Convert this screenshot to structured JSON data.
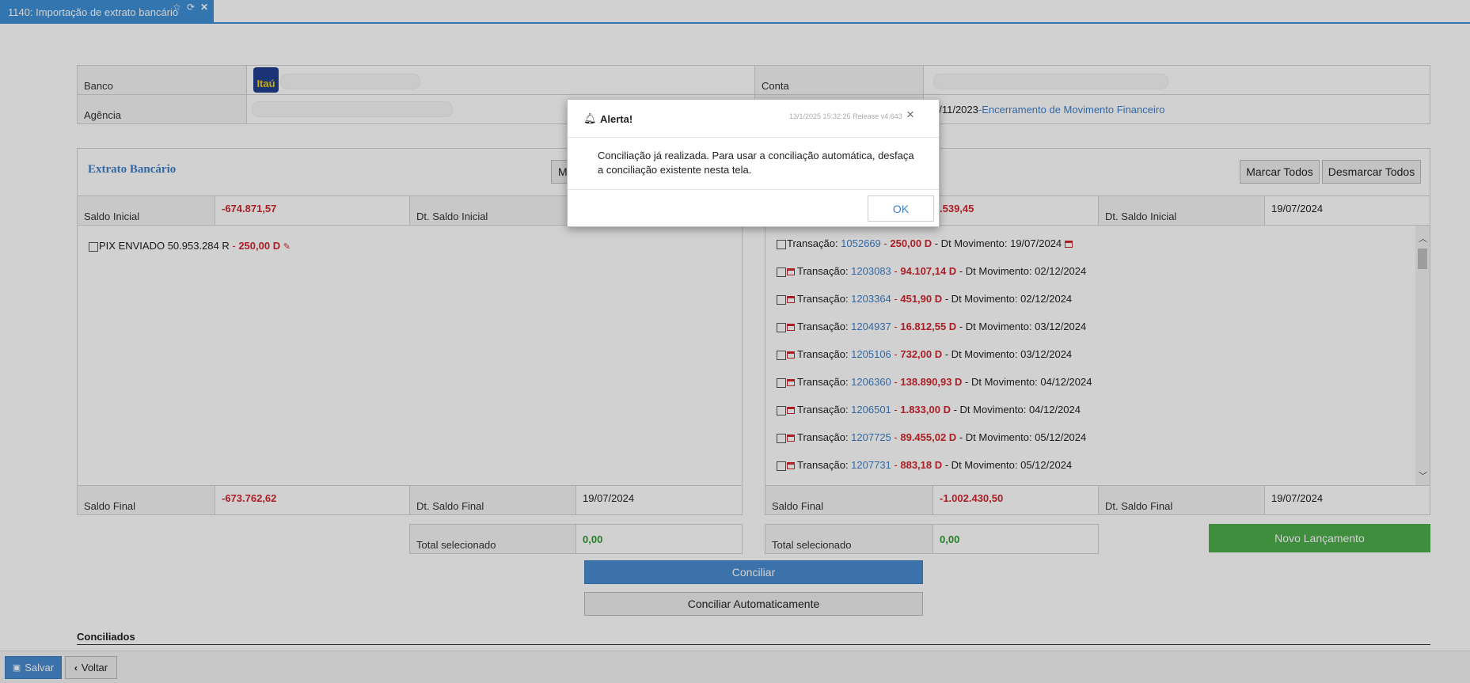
{
  "tab": {
    "title": "1140: Importação de extrato bancário"
  },
  "header": {
    "banco_label": "Banco",
    "bank_logo_text": "Itaú",
    "agencia_label": "Agência",
    "conta_label": "Conta",
    "movimento_date": "0/11/2023",
    "movimento_sep": " - ",
    "movimento_link": "Encerramento de Movimento Financeiro"
  },
  "left_panel": {
    "title": "Extrato Bancário",
    "partial_button": "M",
    "saldo_inicial_label": "Saldo Inicial",
    "saldo_inicial_value": "-674.871,57",
    "dt_saldo_inicial_label": "Dt. Saldo Inicial",
    "entries": [
      {
        "desc": "PIX ENVIADO 50.953.284 R",
        "sep": " - ",
        "value": "250,00 D"
      }
    ],
    "saldo_final_label": "Saldo Final",
    "saldo_final_value": "-673.762,62",
    "dt_saldo_final_label": "Dt. Saldo Final",
    "dt_saldo_final_value": "19/07/2024",
    "total_label": "Total selecionado",
    "total_value": "0,00"
  },
  "right_panel": {
    "marcar_todos": "Marcar Todos",
    "desmarcar_todos": "Desmarcar Todos",
    "saldo_inicial_value_partial": ".539,45",
    "dt_saldo_inicial_label": "Dt. Saldo Inicial",
    "dt_saldo_inicial_value": "19/07/2024",
    "tx_label": "Transação: ",
    "dt_label": " - Dt Movimento: ",
    "transactions": [
      {
        "id": "1052669",
        "value": "250,00 D",
        "date": "19/07/2024"
      },
      {
        "id": "1203083",
        "value": "94.107,14 D",
        "date": "02/12/2024"
      },
      {
        "id": "1203364",
        "value": "451,90 D",
        "date": "02/12/2024"
      },
      {
        "id": "1204937",
        "value": "16.812,55 D",
        "date": "03/12/2024"
      },
      {
        "id": "1205106",
        "value": "732,00 D",
        "date": "03/12/2024"
      },
      {
        "id": "1206360",
        "value": "138.890,93 D",
        "date": "04/12/2024"
      },
      {
        "id": "1206501",
        "value": "1.833,00 D",
        "date": "04/12/2024"
      },
      {
        "id": "1207725",
        "value": "89.455,02 D",
        "date": "05/12/2024"
      },
      {
        "id": "1207731",
        "value": "883,18 D",
        "date": "05/12/2024"
      }
    ],
    "saldo_final_label": "Saldo Final",
    "saldo_final_value": "-1.002.430,50",
    "dt_saldo_final_label": "Dt. Saldo Final",
    "dt_saldo_final_value": "19/07/2024",
    "total_label": "Total selecionado",
    "total_value": "0,00",
    "novo_lancamento": "Novo Lançamento"
  },
  "actions": {
    "conciliar": "Conciliar",
    "conciliar_auto": "Conciliar Automaticamente"
  },
  "section": {
    "conciliados": "Conciliados"
  },
  "footer": {
    "salvar": "Salvar",
    "voltar": "Voltar"
  },
  "modal": {
    "title": "Alerta!",
    "meta": "13/1/2025 15:32:25 Release v4.643",
    "close": "×",
    "message": "Conciliação já realizada. Para usar a conciliação automática, desfaça a conciliação existente nesta tela.",
    "ok": "OK"
  },
  "colors": {
    "accent": "#3d8fd6",
    "negative": "#d0262e",
    "positive": "#2e9a2e",
    "primary_button": "#4a8bd0",
    "success_button": "#4cae4c"
  }
}
